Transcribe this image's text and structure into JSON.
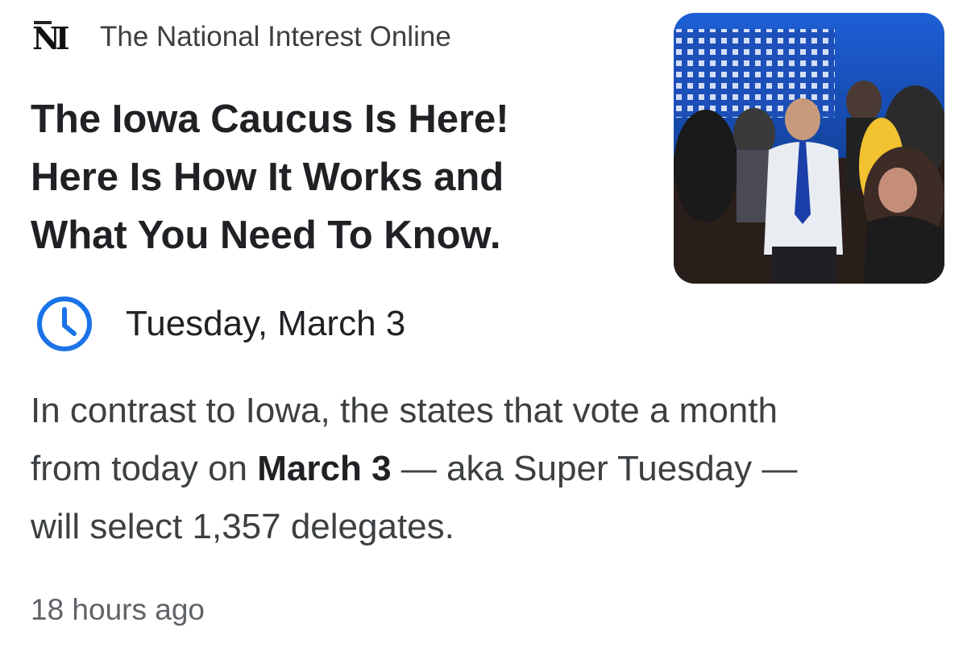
{
  "source": {
    "logo_text": "NI",
    "name": "The National Interest Online"
  },
  "article": {
    "headline_lines": [
      "The Iowa Caucus Is Here!",
      "Here Is How It Works and",
      "What You Need To Know."
    ],
    "thumbnail_icon": "news-photo-thumbnail"
  },
  "event": {
    "icon": "clock-icon",
    "date": "Tuesday, March 3"
  },
  "snippet": {
    "line1": "In contrast to Iowa, the states that vote a month",
    "line2_before": "from today on ",
    "line2_bold": "March 3",
    "line2_after": " — aka Super Tuesday —",
    "line3": "will select 1,357 delegates."
  },
  "meta": {
    "timestamp": "18 hours ago"
  },
  "colors": {
    "headline": "#202124",
    "body_text": "#3c4043",
    "secondary_text": "#5f6368",
    "accent_blue": "#1a73e8"
  }
}
